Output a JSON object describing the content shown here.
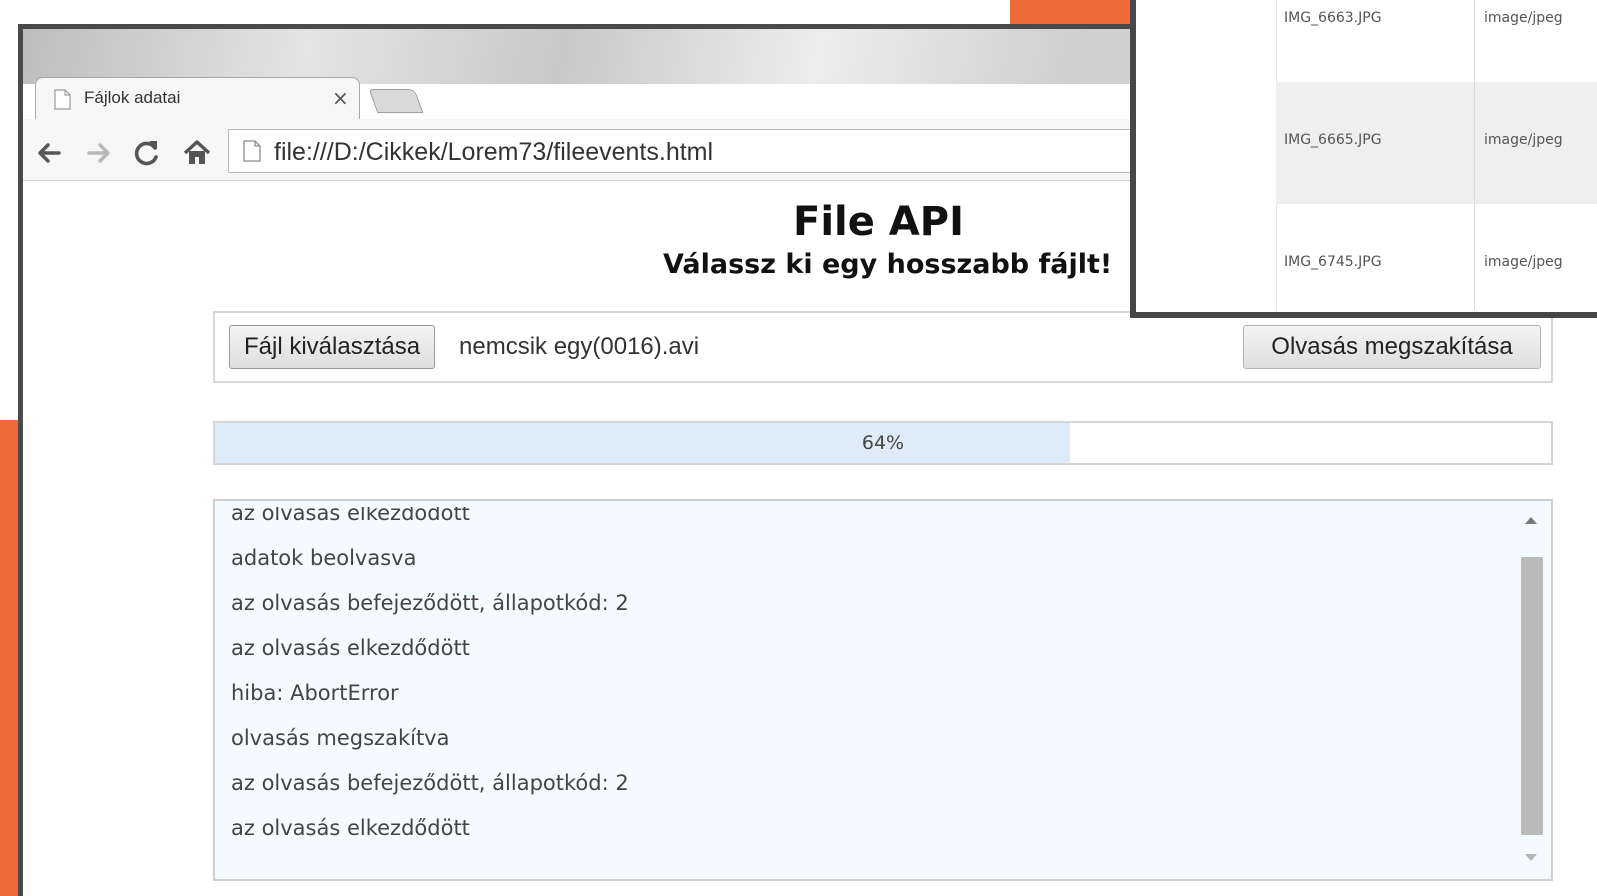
{
  "browser": {
    "tab_title": "Fájlok adatai",
    "tab_close": "×",
    "url": "file:///D:/Cikkek/Lorem73/fileevents.html"
  },
  "page": {
    "title": "File API",
    "subtitle": "Válassz ki egy hosszabb fájlt!"
  },
  "file_picker": {
    "choose_label": "Fájl kiválasztása",
    "file_name": "nemcsik egy(0016).avi",
    "abort_label": "Olvasás megszakítása"
  },
  "progress": {
    "percent": 64,
    "label": "64%"
  },
  "log": {
    "lines": [
      "az olvasás elkezdődött",
      "adatok beolvasva",
      "az olvasás befejeződött, állapotkód: 2",
      "az olvasás elkezdődött",
      "hiba: AbortError",
      "olvasás megszakítva",
      "az olvasás befejeződött, állapotkód: 2",
      "az olvasás elkezdődött"
    ]
  },
  "file_table": {
    "rows": [
      {
        "name": "IMG_6663.JPG",
        "type": "image/jpeg"
      },
      {
        "name": "IMG_6665.JPG",
        "type": "image/jpeg"
      },
      {
        "name": "IMG_6745.JPG",
        "type": "image/jpeg"
      }
    ]
  },
  "colors": {
    "accent_orange": "#ee6a39",
    "progress_fill": "#deebf8",
    "log_background": "#f4fbff"
  },
  "icons": {
    "tab": "document-icon",
    "back": "back-arrow-icon",
    "forward": "forward-arrow-icon",
    "reload": "reload-icon",
    "home": "home-icon",
    "page": "document-icon"
  }
}
